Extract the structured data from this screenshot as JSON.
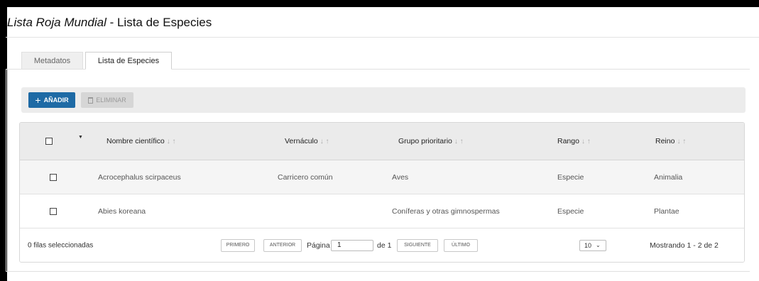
{
  "title": {
    "italic": "Lista Roja Mundial",
    "rest": " - Lista de Especies"
  },
  "tabs": [
    {
      "label": "Metadatos"
    },
    {
      "label": "Lista de Especies"
    }
  ],
  "toolbar": {
    "add_label": "AÑADIR",
    "delete_label": "ELIMINAR"
  },
  "table": {
    "columns": [
      "Nombre científico",
      "Vernáculo",
      "Grupo prioritario",
      "Rango",
      "Reino"
    ],
    "sort_glyphs": "↓ ↑",
    "rows": [
      {
        "nombre": "Acrocephalus scirpaceus",
        "vernaculo": "Carricero común",
        "grupo": "Aves",
        "rango": "Especie",
        "reino": "Animalia"
      },
      {
        "nombre": "Abies koreana",
        "vernaculo": "",
        "grupo": "Coníferas y otras gimnospermas",
        "rango": "Especie",
        "reino": "Plantae"
      }
    ]
  },
  "footer": {
    "selected": "0 filas seleccionadas",
    "first": "PRIMERO",
    "prev": "ANTERIOR",
    "page_label": "Página",
    "page_value": "1",
    "of_label": "de 1",
    "next": "SIGUIENTE",
    "last": "ÚLTIMO",
    "page_size": "10",
    "showing": "Mostrando 1 - 2 de 2"
  }
}
